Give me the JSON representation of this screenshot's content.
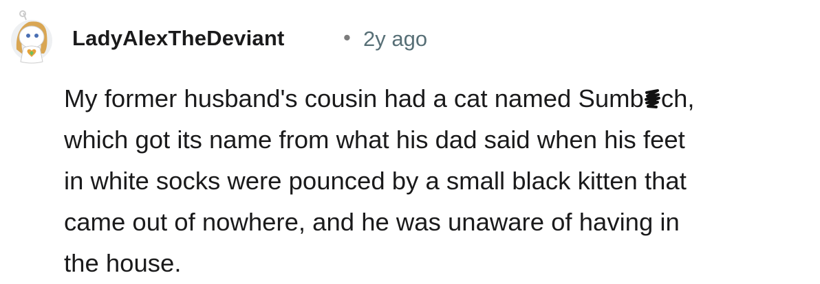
{
  "comment": {
    "author": "LadyAlexTheDeviant",
    "separator": "•",
    "time_ago": "2y ago",
    "body_lines": [
      {
        "before": "My former husband's cousin had a cat named Sumb",
        "after": "ch,"
      },
      "which got its name from what his dad said when his feet",
      "in white socks were pounced by a small black kitten that",
      "came out of nowhere, and he was unaware of having in",
      "the house."
    ]
  },
  "icons": {
    "avatar": "reddit-snoo-avatar-icon",
    "censor": "black-scribble-censor-icon"
  },
  "colors": {
    "text": "#1a1a1b",
    "meta": "#576f76",
    "background": "#ffffff"
  }
}
